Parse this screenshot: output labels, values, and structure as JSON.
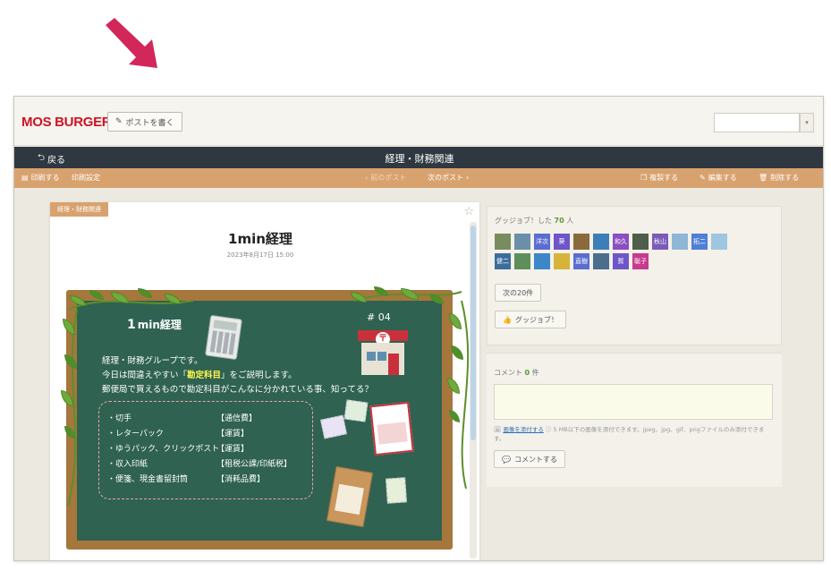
{
  "colors": {
    "arrow": "#d2275b",
    "brand_red": "#d01126",
    "titlebar": "#2f3841",
    "actionbar": "#d8a26f",
    "board": "#2f6250",
    "frame": "#a6773c",
    "count_green": "#5a9a36"
  },
  "header": {
    "logo": "MOS BURGER",
    "write_post": "ポストを書く"
  },
  "titlebar": {
    "back": "戻る",
    "title": "経理・財務関連"
  },
  "actionbar": {
    "print": "印刷する",
    "print_settings": "印刷設定",
    "prev_post": "前のポスト",
    "next_post": "次のポスト",
    "copy": "複製する",
    "edit": "編集する",
    "delete": "削除する"
  },
  "post": {
    "category": "経理・財務関連",
    "title": "1min経理",
    "date": "2023年8月17日 15:00",
    "board": {
      "title_num": "1",
      "title_text": "min経理",
      "number": "# 04",
      "line1": "経理・財務グループです。",
      "line2_pre": "今日は間違えやすい「",
      "line2_hl": "勘定科目",
      "line2_post": "」をご説明します。",
      "line3": "郵便局で買えるもので勘定科目がこんなに分かれている事、知ってる？",
      "items": [
        "・切手",
        "・レターパック",
        "・ゆうパック、クリックポスト",
        "・収入印紙",
        "・便箋、現金書留封筒"
      ],
      "accounts": [
        "【通信費】",
        "【運賃】",
        "【運賃】",
        "【租税公課/印紙税】",
        "【消耗品費】"
      ]
    }
  },
  "likes": {
    "label": "グッジョブ！した",
    "count": "70",
    "unit": "人",
    "avatars": [
      {
        "label": "",
        "color": "#7a8c5e"
      },
      {
        "label": "",
        "color": "#6b8fa8"
      },
      {
        "label": "洋次",
        "color": "#5b6dd0"
      },
      {
        "label": "葵",
        "color": "#6e55c8"
      },
      {
        "label": "",
        "color": "#8a6a3d"
      },
      {
        "label": "",
        "color": "#3c7fb8"
      },
      {
        "label": "和久",
        "color": "#8a4fc0"
      },
      {
        "label": "",
        "color": "#4f5e4a"
      },
      {
        "label": "秋山",
        "color": "#7b5ab8"
      },
      {
        "label": "",
        "color": "#8fb6d6"
      },
      {
        "label": "拓二",
        "color": "#4f7fd6"
      },
      {
        "label": "",
        "color": "#9fc6e0"
      },
      {
        "label": "健二",
        "color": "#3c6e9c"
      },
      {
        "label": "",
        "color": "#5e8e5a"
      },
      {
        "label": "",
        "color": "#3d87c9"
      },
      {
        "label": "",
        "color": "#d6b43c"
      },
      {
        "label": "直樹",
        "color": "#5b6dd0"
      },
      {
        "label": "",
        "color": "#4a6e8c"
      },
      {
        "label": "賀",
        "color": "#6e55c8"
      },
      {
        "label": "聡子",
        "color": "#c83a8e"
      }
    ],
    "next_button": "次の20件",
    "goodjob_button": "グッジョブ！"
  },
  "comments": {
    "label": "コメント",
    "count": "0",
    "unit": "件",
    "attach_link": "画像を添付する",
    "attach_note": "5 MB以下の画像を添付できます。jpeg、jpg、gif、pngファイルのみ添付できます。",
    "submit": "コメントする"
  }
}
